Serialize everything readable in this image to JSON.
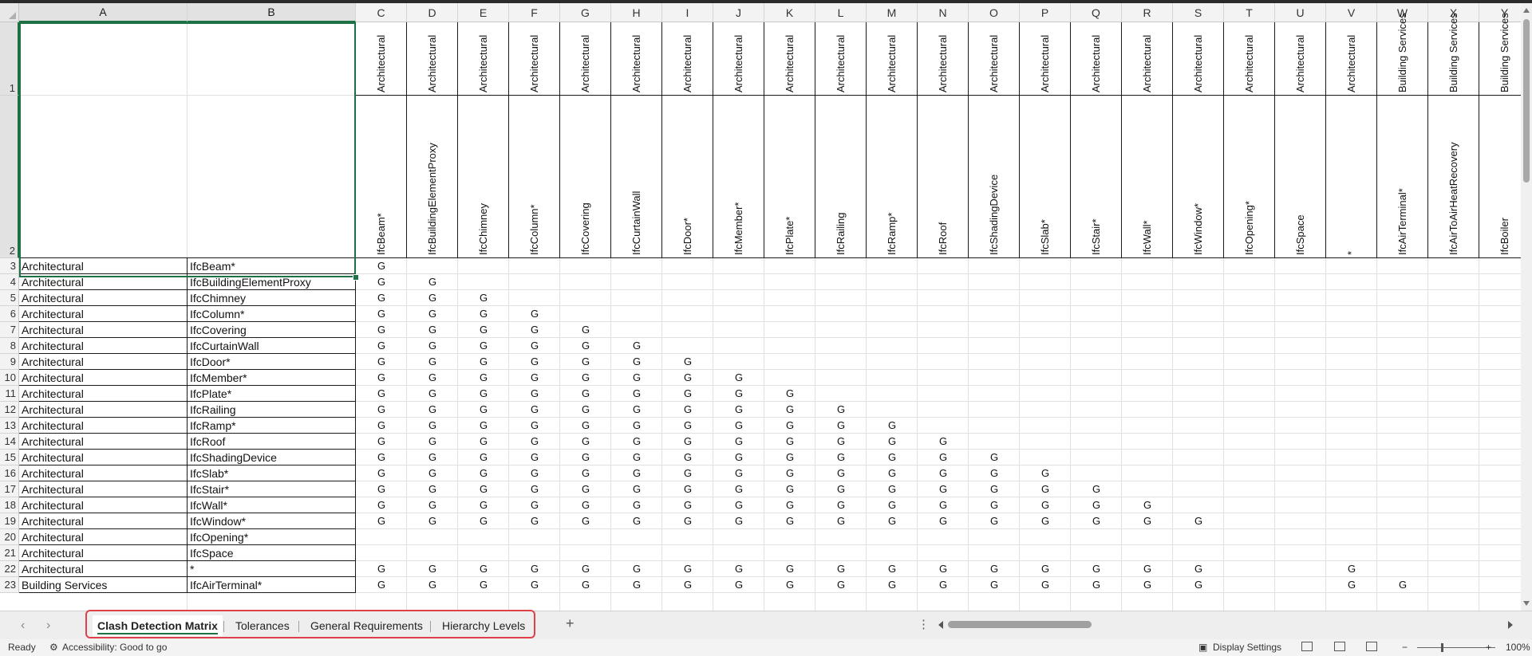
{
  "columns": {
    "letters": [
      "A",
      "B",
      "C",
      "D",
      "E",
      "F",
      "G",
      "H",
      "I",
      "J",
      "K",
      "L",
      "M",
      "N",
      "O",
      "P",
      "Q",
      "R",
      "S",
      "T",
      "U",
      "V",
      "W",
      "X",
      "Y"
    ]
  },
  "header_rows": {
    "row1": [
      "Architectural",
      "Architectural",
      "Architectural",
      "Architectural",
      "Architectural",
      "Architectural",
      "Architectural",
      "Architectural",
      "Architectural",
      "Architectural",
      "Architectural",
      "Architectural",
      "Architectural",
      "Architectural",
      "Architectural",
      "Architectural",
      "Architectural",
      "Architectural",
      "Architectural",
      "Architectural",
      "Building Services",
      "Building Services",
      "Building Services"
    ],
    "row2": [
      "IfcBeam*",
      "IfcBuildingElementProxy",
      "IfcChimney",
      "IfcColumn*",
      "IfcCovering",
      "IfcCurtainWall",
      "IfcDoor*",
      "IfcMember*",
      "IfcPlate*",
      "IfcRailing",
      "IfcRamp*",
      "IfcRoof",
      "IfcShadingDevice",
      "IfcSlab*",
      "IfcStair*",
      "IfcWall*",
      "IfcWindow*",
      "IfcOpening*",
      "IfcSpace",
      "*",
      "IfcAirTerminal*",
      "IfcAirToAirHeatRecovery",
      "IfcBoiler"
    ]
  },
  "rows": [
    {
      "num": "3",
      "a": "Architectural",
      "b": "IfcBeam*",
      "g": [
        "G",
        "",
        "",
        "",
        "",
        "",
        "",
        "",
        "",
        "",
        "",
        "",
        "",
        "",
        "",
        "",
        "",
        "",
        "",
        "",
        "",
        "",
        ""
      ]
    },
    {
      "num": "4",
      "a": "Architectural",
      "b": "IfcBuildingElementProxy",
      "g": [
        "G",
        "G",
        "",
        "",
        "",
        "",
        "",
        "",
        "",
        "",
        "",
        "",
        "",
        "",
        "",
        "",
        "",
        "",
        "",
        "",
        "",
        "",
        ""
      ]
    },
    {
      "num": "5",
      "a": "Architectural",
      "b": "IfcChimney",
      "g": [
        "G",
        "G",
        "G",
        "",
        "",
        "",
        "",
        "",
        "",
        "",
        "",
        "",
        "",
        "",
        "",
        "",
        "",
        "",
        "",
        "",
        "",
        "",
        ""
      ]
    },
    {
      "num": "6",
      "a": "Architectural",
      "b": "IfcColumn*",
      "g": [
        "G",
        "G",
        "G",
        "G",
        "",
        "",
        "",
        "",
        "",
        "",
        "",
        "",
        "",
        "",
        "",
        "",
        "",
        "",
        "",
        "",
        "",
        "",
        ""
      ]
    },
    {
      "num": "7",
      "a": "Architectural",
      "b": "IfcCovering",
      "g": [
        "G",
        "G",
        "G",
        "G",
        "G",
        "",
        "",
        "",
        "",
        "",
        "",
        "",
        "",
        "",
        "",
        "",
        "",
        "",
        "",
        "",
        "",
        "",
        ""
      ]
    },
    {
      "num": "8",
      "a": "Architectural",
      "b": "IfcCurtainWall",
      "g": [
        "G",
        "G",
        "G",
        "G",
        "G",
        "G",
        "",
        "",
        "",
        "",
        "",
        "",
        "",
        "",
        "",
        "",
        "",
        "",
        "",
        "",
        "",
        "",
        ""
      ]
    },
    {
      "num": "9",
      "a": "Architectural",
      "b": "IfcDoor*",
      "g": [
        "G",
        "G",
        "G",
        "G",
        "G",
        "G",
        "G",
        "",
        "",
        "",
        "",
        "",
        "",
        "",
        "",
        "",
        "",
        "",
        "",
        "",
        "",
        "",
        ""
      ]
    },
    {
      "num": "10",
      "a": "Architectural",
      "b": "IfcMember*",
      "g": [
        "G",
        "G",
        "G",
        "G",
        "G",
        "G",
        "G",
        "G",
        "",
        "",
        "",
        "",
        "",
        "",
        "",
        "",
        "",
        "",
        "",
        "",
        "",
        "",
        ""
      ]
    },
    {
      "num": "11",
      "a": "Architectural",
      "b": "IfcPlate*",
      "g": [
        "G",
        "G",
        "G",
        "G",
        "G",
        "G",
        "G",
        "G",
        "G",
        "",
        "",
        "",
        "",
        "",
        "",
        "",
        "",
        "",
        "",
        "",
        "",
        "",
        ""
      ]
    },
    {
      "num": "12",
      "a": "Architectural",
      "b": "IfcRailing",
      "g": [
        "G",
        "G",
        "G",
        "G",
        "G",
        "G",
        "G",
        "G",
        "G",
        "G",
        "",
        "",
        "",
        "",
        "",
        "",
        "",
        "",
        "",
        "",
        "",
        "",
        ""
      ]
    },
    {
      "num": "13",
      "a": "Architectural",
      "b": "IfcRamp*",
      "g": [
        "G",
        "G",
        "G",
        "G",
        "G",
        "G",
        "G",
        "G",
        "G",
        "G",
        "G",
        "",
        "",
        "",
        "",
        "",
        "",
        "",
        "",
        "",
        "",
        "",
        ""
      ]
    },
    {
      "num": "14",
      "a": "Architectural",
      "b": "IfcRoof",
      "g": [
        "G",
        "G",
        "G",
        "G",
        "G",
        "G",
        "G",
        "G",
        "G",
        "G",
        "G",
        "G",
        "",
        "",
        "",
        "",
        "",
        "",
        "",
        "",
        "",
        "",
        ""
      ]
    },
    {
      "num": "15",
      "a": "Architectural",
      "b": "IfcShadingDevice",
      "g": [
        "G",
        "G",
        "G",
        "G",
        "G",
        "G",
        "G",
        "G",
        "G",
        "G",
        "G",
        "G",
        "G",
        "",
        "",
        "",
        "",
        "",
        "",
        "",
        "",
        "",
        ""
      ]
    },
    {
      "num": "16",
      "a": "Architectural",
      "b": "IfcSlab*",
      "g": [
        "G",
        "G",
        "G",
        "G",
        "G",
        "G",
        "G",
        "G",
        "G",
        "G",
        "G",
        "G",
        "G",
        "G",
        "",
        "",
        "",
        "",
        "",
        "",
        "",
        "",
        ""
      ]
    },
    {
      "num": "17",
      "a": "Architectural",
      "b": "IfcStair*",
      "g": [
        "G",
        "G",
        "G",
        "G",
        "G",
        "G",
        "G",
        "G",
        "G",
        "G",
        "G",
        "G",
        "G",
        "G",
        "G",
        "",
        "",
        "",
        "",
        "",
        "",
        "",
        ""
      ]
    },
    {
      "num": "18",
      "a": "Architectural",
      "b": "IfcWall*",
      "g": [
        "G",
        "G",
        "G",
        "G",
        "G",
        "G",
        "G",
        "G",
        "G",
        "G",
        "G",
        "G",
        "G",
        "G",
        "G",
        "G",
        "",
        "",
        "",
        "",
        "",
        "",
        ""
      ]
    },
    {
      "num": "19",
      "a": "Architectural",
      "b": "IfcWindow*",
      "g": [
        "G",
        "G",
        "G",
        "G",
        "G",
        "G",
        "G",
        "G",
        "G",
        "G",
        "G",
        "G",
        "G",
        "G",
        "G",
        "G",
        "G",
        "",
        "",
        "",
        "",
        "",
        ""
      ]
    },
    {
      "num": "20",
      "a": "Architectural",
      "b": "IfcOpening*",
      "g": [
        "",
        "",
        "",
        "",
        "",
        "",
        "",
        "",
        "",
        "",
        "",
        "",
        "",
        "",
        "",
        "",
        "",
        "",
        "",
        "",
        "",
        "",
        ""
      ]
    },
    {
      "num": "21",
      "a": "Architectural",
      "b": "IfcSpace",
      "g": [
        "",
        "",
        "",
        "",
        "",
        "",
        "",
        "",
        "",
        "",
        "",
        "",
        "",
        "",
        "",
        "",
        "",
        "",
        "",
        "",
        "",
        "",
        ""
      ]
    },
    {
      "num": "22",
      "a": "Architectural",
      "b": "*",
      "g": [
        "G",
        "G",
        "G",
        "G",
        "G",
        "G",
        "G",
        "G",
        "G",
        "G",
        "G",
        "G",
        "G",
        "G",
        "G",
        "G",
        "G",
        "",
        "",
        "G",
        "",
        "",
        ""
      ]
    },
    {
      "num": "23",
      "a": "Building Services",
      "b": "IfcAirTerminal*",
      "g": [
        "G",
        "G",
        "G",
        "G",
        "G",
        "G",
        "G",
        "G",
        "G",
        "G",
        "G",
        "G",
        "G",
        "G",
        "G",
        "G",
        "G",
        "",
        "",
        "G",
        "G",
        "",
        ""
      ]
    }
  ],
  "sheet_tabs": {
    "items": [
      "Clash Detection Matrix",
      "Tolerances",
      "General Requirements",
      "Hierarchy Levels"
    ],
    "active_index": 0,
    "add_sheet": "+"
  },
  "status_bar": {
    "ready": "Ready",
    "accessibility": "Accessibility: Good to go",
    "display_settings": "Display Settings",
    "zoom_minus": "−",
    "zoom_plus": "+",
    "zoom": "100%"
  },
  "colors": {
    "selection_accent": "#1e7145",
    "tab_highlight": "#e0404a"
  }
}
